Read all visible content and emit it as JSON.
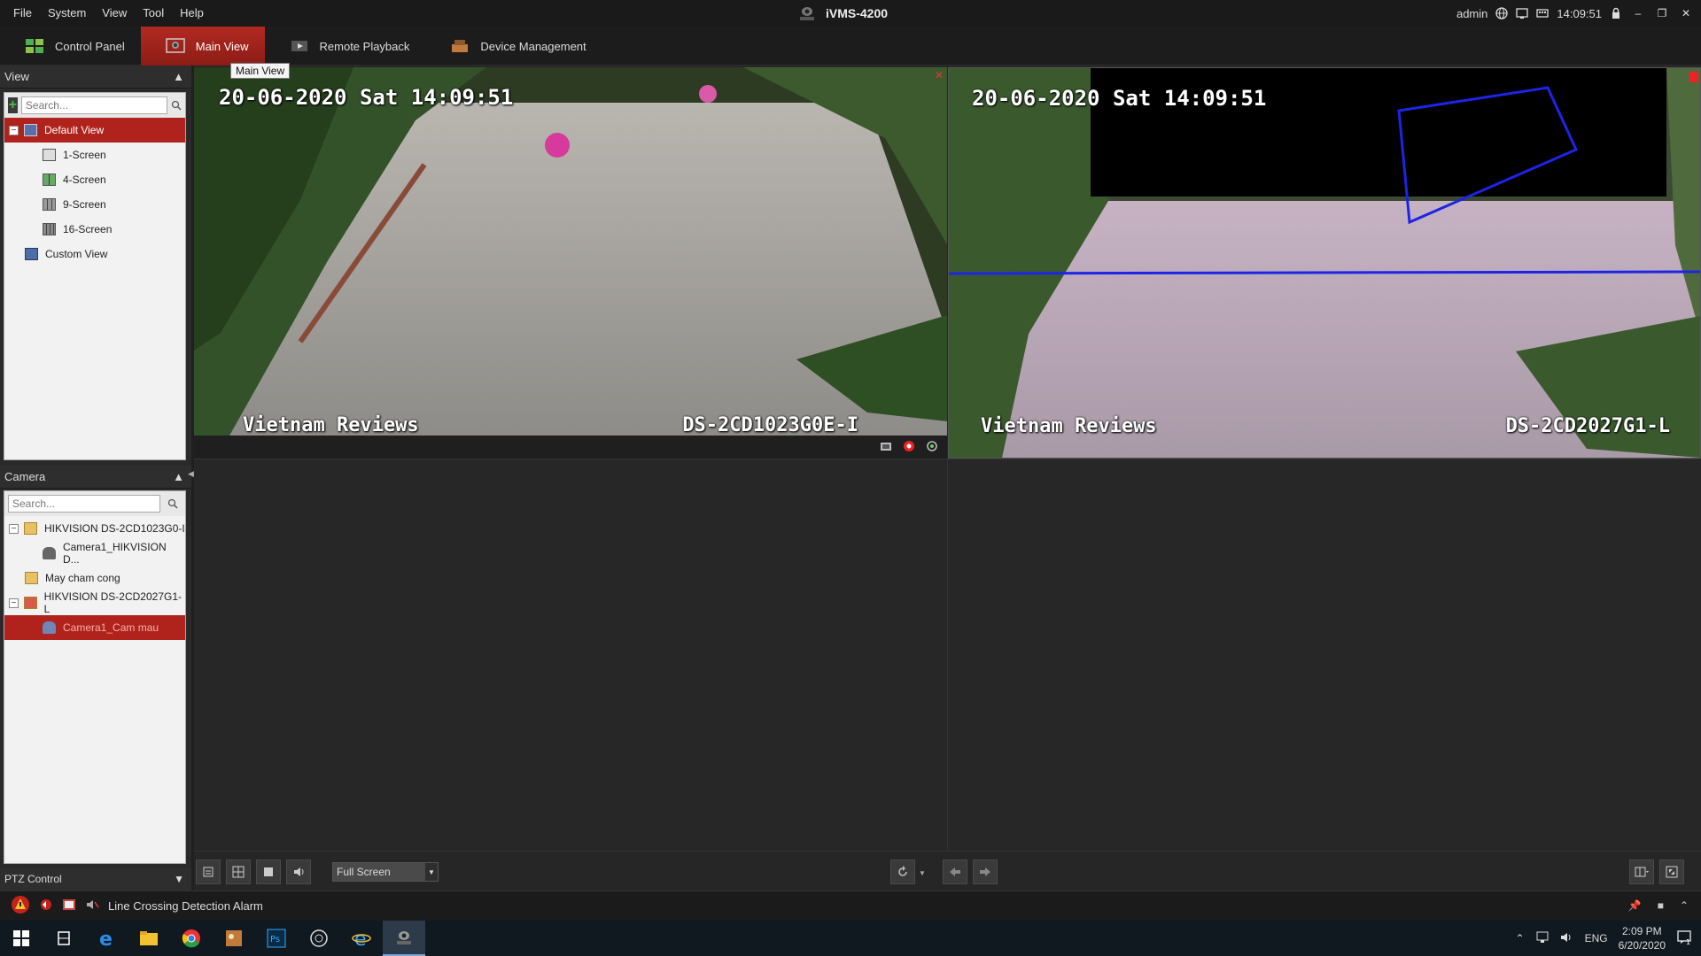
{
  "menu": [
    "File",
    "System",
    "View",
    "Tool",
    "Help"
  ],
  "app_title": "iVMS-4200",
  "title_right": {
    "user": "admin",
    "time": "14:09:51"
  },
  "tabs": [
    {
      "label": "Control Panel",
      "active": false
    },
    {
      "label": "Main View",
      "active": true
    },
    {
      "label": "Remote Playback",
      "active": false
    },
    {
      "label": "Device Management",
      "active": false
    }
  ],
  "tooltip": "Main View",
  "view_panel": {
    "title": "View",
    "search_placeholder": "Search...",
    "items": [
      "Default View",
      "1-Screen",
      "4-Screen",
      "9-Screen",
      "16-Screen",
      "Custom View"
    ]
  },
  "camera_panel": {
    "title": "Camera",
    "search_placeholder": "Search...",
    "items": [
      "HIKVISION DS-2CD1023G0-I",
      "Camera1_HIKVISION D...",
      "May cham cong",
      "HIKVISION DS-2CD2027G1-L",
      "Camera1_Cam mau"
    ]
  },
  "ptz_label": "PTZ Control",
  "cam1": {
    "timestamp": "20-06-2020 Sat 14:09:51",
    "label_left": "Vietnam Reviews",
    "label_right": "DS-2CD1023G0E-I"
  },
  "cam2": {
    "timestamp": "20-06-2020 Sat 14:09:51",
    "label_left": "Vietnam Reviews",
    "label_right": "DS-2CD2027G1-L"
  },
  "toolbar": {
    "screen_mode": "Full Screen"
  },
  "alarm": {
    "text": "Line Crossing Detection Alarm"
  },
  "taskbar": {
    "lang": "ENG",
    "time": "2:09 PM",
    "date": "6/20/2020"
  },
  "colors": {
    "accent_red": "#b0231c",
    "detection_blue": "#1c24e6"
  }
}
